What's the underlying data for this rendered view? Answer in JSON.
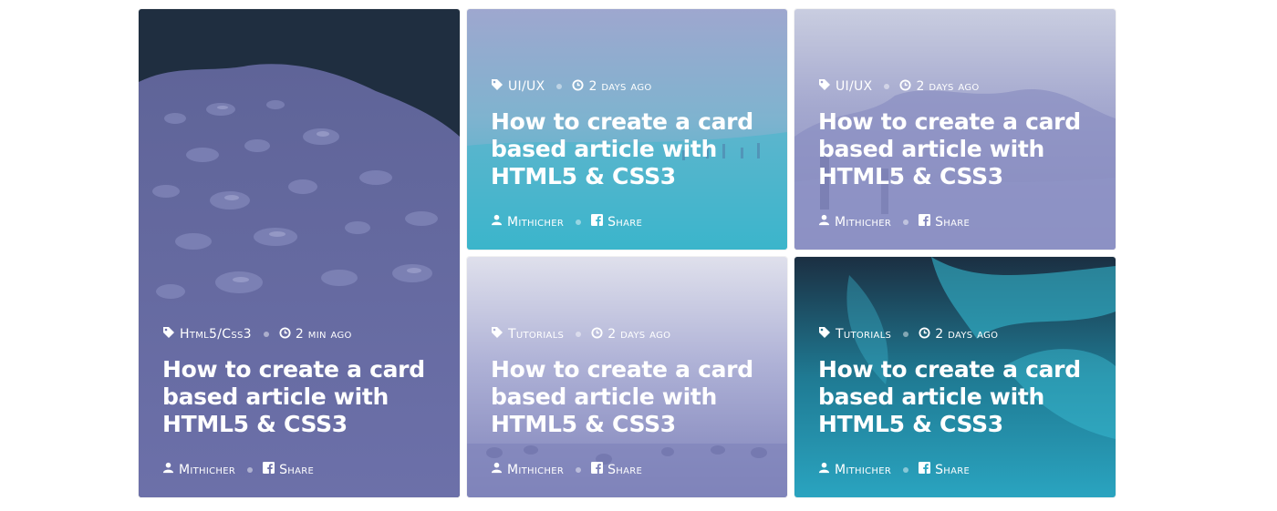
{
  "cards": [
    {
      "category": "Html5/Css3",
      "time": "2 min ago",
      "title": "How to create a card based article with HTML5 & CSS3",
      "author": "Mithicher",
      "share_label": "Share",
      "image": "water-droplets"
    },
    {
      "category": "UI/UX",
      "time": "2 days ago",
      "title": "How to create a card based article with HTML5 & CSS3",
      "author": "Mithicher",
      "share_label": "Share",
      "image": "beach-people"
    },
    {
      "category": "UI/UX",
      "time": "2 days ago",
      "title": "How to create a card based article with HTML5 & CSS3",
      "author": "Mithicher",
      "share_label": "Share",
      "image": "rocky-coast"
    },
    {
      "category": "Tutorials",
      "time": "2 days ago",
      "title": "How to create a card based article with HTML5 & CSS3",
      "author": "Mithicher",
      "share_label": "Share",
      "image": "hay-bales-field"
    },
    {
      "category": "Tutorials",
      "time": "2 days ago",
      "title": "How to create a card based article with HTML5 & CSS3",
      "author": "Mithicher",
      "share_label": "Share",
      "image": "teal-flower"
    }
  ],
  "icons": {
    "tag": "tag-icon",
    "clock": "clock-icon",
    "user": "user-icon",
    "facebook": "facebook-icon"
  },
  "colors": {
    "purple_overlay": "#6b6fa8",
    "cyan_overlay": "#3bb4cc",
    "dark_teal": "#1a2b3b",
    "text": "#ffffff"
  }
}
